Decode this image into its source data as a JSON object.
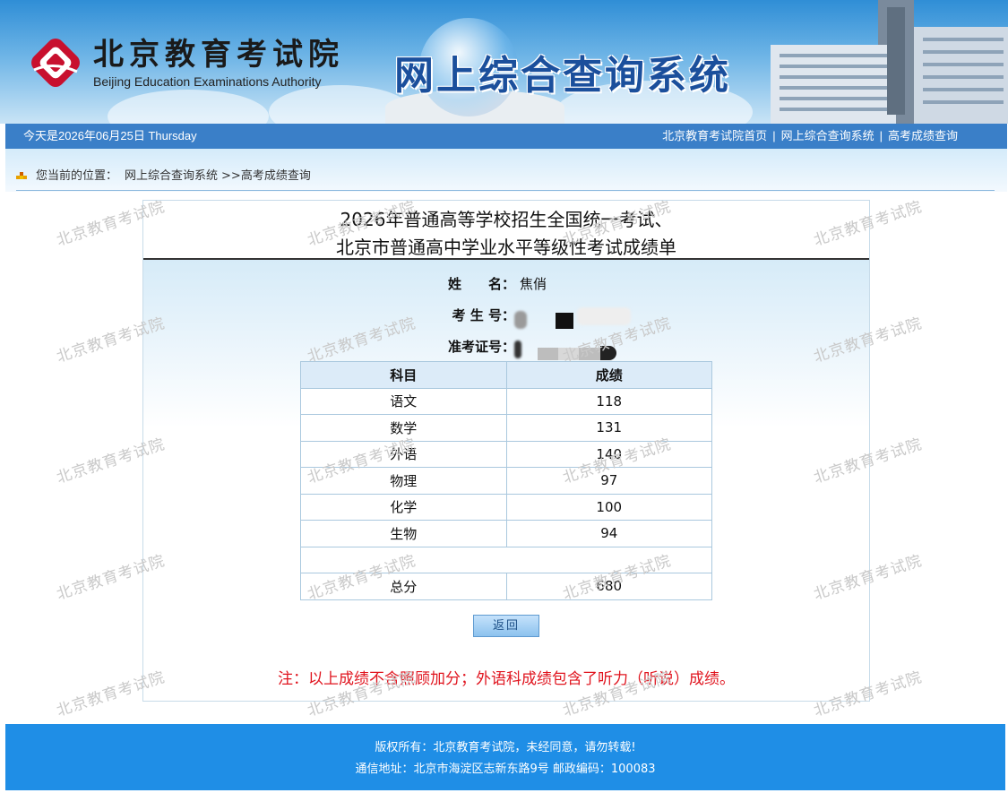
{
  "header": {
    "org_name_cn": "北京教育考试院",
    "org_name_en": "Beijing Education Examinations Authority",
    "system_title": "网上综合查询系统"
  },
  "navbar": {
    "date_text": "今天是2026年06月25日 Thursday",
    "links": [
      "北京教育考试院首页",
      "网上综合查询系统",
      "高考成绩查询"
    ],
    "separator": "|"
  },
  "breadcrumb": {
    "prefix": "您当前的位置：",
    "link": "网上综合查询系统",
    "current": ">>高考成绩查询"
  },
  "watermark_text": "北京教育考试院",
  "report": {
    "title_line1": "2026年普通高等学校招生全国统一考试、",
    "title_line2": "北京市普通高中学业水平等级性考试成绩单",
    "name_label": "姓　　名：",
    "name_value": "焦俏",
    "exam_no_label": "考 生 号：",
    "admission_no_label": "准考证号："
  },
  "scores": {
    "headers": [
      "科目",
      "成绩"
    ],
    "rows": [
      {
        "subject": "语文",
        "score": "118"
      },
      {
        "subject": "数学",
        "score": "131"
      },
      {
        "subject": "外语",
        "score": "140"
      },
      {
        "subject": "物理",
        "score": "97"
      },
      {
        "subject": "化学",
        "score": "100"
      },
      {
        "subject": "生物",
        "score": "94"
      }
    ],
    "total_label": "总分",
    "total_value": "680"
  },
  "back_button_label": "返回",
  "note": "注：以上成绩不含照顾加分；外语科成绩包含了听力（听说）成绩。",
  "footer": {
    "copyright": "版权所有：北京教育考试院，未经同意，请勿转载!",
    "address": "通信地址：北京市海淀区志新东路9号 邮政编码：100083"
  },
  "colors": {
    "nav_blue": "#3a7fc8",
    "footer_blue": "#1f8ee6",
    "note_red": "#e0141e",
    "title_blue": "#1b4f9c",
    "logo_red": "#c8102e"
  }
}
